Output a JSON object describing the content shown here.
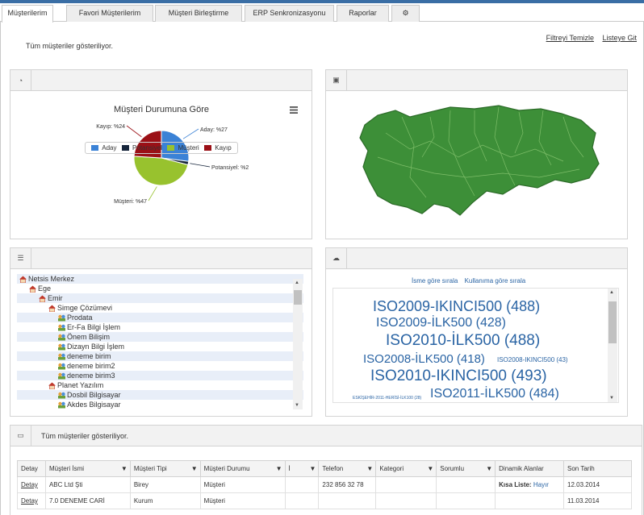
{
  "tabs": [
    {
      "label": "Müşterilerim"
    },
    {
      "label": "Favori Müşterilerim"
    },
    {
      "label": "Müşteri Birleştirme"
    },
    {
      "label": "ERP Senkronizasyonu"
    },
    {
      "label": "Raporlar"
    },
    {
      "label": "⚙"
    }
  ],
  "status_text": "Tüm müşteriler gösteriliyor.",
  "links": {
    "clear_filter": "Filtreyi Temizle",
    "list_view": "Listeye Git"
  },
  "chart_data": {
    "type": "pie",
    "title": "Müşteri Durumuna Göre",
    "categories": [
      "Aday",
      "Potansiyel",
      "Müşteri",
      "Kayıp"
    ],
    "values": [
      27,
      2,
      47,
      24
    ],
    "data_labels": [
      "Aday: %27",
      "Potansiyel: %2",
      "Müşteri: %47",
      "Kayıp: %24"
    ],
    "colors": [
      "#3b82d6",
      "#15243a",
      "#98c22e",
      "#9b1016"
    ],
    "legend": "bottom"
  },
  "map": {
    "fill": "#3d8f38"
  },
  "tree": [
    {
      "label": "Netsis Merkez",
      "level": 0
    },
    {
      "label": "Ege",
      "level": 1
    },
    {
      "label": "Emir",
      "level": 2
    },
    {
      "label": "Simge Çözümevi",
      "level": 3
    },
    {
      "label": "Prodata",
      "level": 4
    },
    {
      "label": "Er-Fa Bilgi İşlem",
      "level": 4
    },
    {
      "label": "Önem Bilişim",
      "level": 4
    },
    {
      "label": "Dizayn Bilgi İşlem",
      "level": 4
    },
    {
      "label": "deneme birim",
      "level": 4
    },
    {
      "label": "deneme birim2",
      "level": 4
    },
    {
      "label": "deneme birim3",
      "level": 4
    },
    {
      "label": "Planet Yazılım",
      "level": 3
    },
    {
      "label": "Dosbil Bilgisayar",
      "level": 4
    },
    {
      "label": "Akdes Bilgisayar",
      "level": 4
    }
  ],
  "cloud": {
    "sort_by_name": "İsme göre sırala",
    "sort_by_usage": "Kullanıma göre sırala",
    "tags": [
      "ISO2009-IKINCI500 (488)",
      "ISO2009-İLK500 (428)",
      "ISO2010-İLK500 (488)",
      "ISO2008-İLK500 (418)",
      "ISO2008-IKINCI500 (43)",
      "ISO2010-IKINCI500 (493)",
      "ESKİŞEHİR-2011-HERİSİ-İLK100 (28)",
      "ISO2011-İLK500 (484)"
    ]
  },
  "grid": {
    "title": "Tüm müşteriler gösteriliyor.",
    "columns": [
      "Detay",
      "Müşteri İsmi",
      "Müşteri Tipi",
      "Müşteri Durumu",
      "İ",
      "Telefon",
      "Kategori",
      "Sorumlu",
      "Dinamik Alanlar",
      "Son Tarih"
    ],
    "rows": [
      {
        "detay": "Detay",
        "name": "ABC Ltd Şti",
        "type": "Birey",
        "state": "Müşteri",
        "i": "",
        "phone": "232 856 32 78",
        "cat": "",
        "resp": "",
        "dyn_label": "Kısa Liste:",
        "dyn_value": "Hayır",
        "date": "12.03.2014"
      },
      {
        "detay": "Detay",
        "name": "7.0 DENEME CARİ",
        "type": "Kurum",
        "state": "Müşteri",
        "i": "",
        "phone": "",
        "cat": "",
        "resp": "",
        "dyn_label": "",
        "dyn_value": "",
        "date": "11.03.2014"
      }
    ]
  }
}
